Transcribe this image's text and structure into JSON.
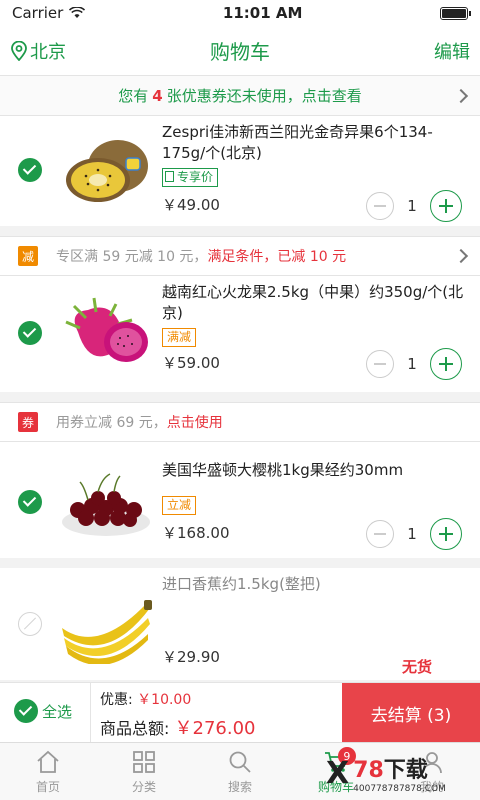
{
  "status": {
    "carrier": "Carrier",
    "time": "11:01 AM"
  },
  "nav": {
    "location": "北京",
    "title": "购物车",
    "edit": "编辑"
  },
  "coupon": {
    "prefix": "您有",
    "count": "4",
    "suffix": "张优惠券还未使用，点击查看"
  },
  "items": [
    {
      "name": "Zespri佳沛新西兰阳光金奇异果6个134-175g/个(北京)",
      "tag": "专享价",
      "price": "￥49.00",
      "qty": "1",
      "checked": true
    },
    {
      "name": "越南红心火龙果2.5kg（中果）约350g/个(北京)",
      "tag": "满减",
      "price": "￥59.00",
      "qty": "1",
      "checked": true
    },
    {
      "name": "美国华盛顿大樱桃1kg果经约30mm",
      "tag": "立减",
      "price": "￥168.00",
      "qty": "1",
      "checked": true
    },
    {
      "name": "进口香蕉约1.5kg(整把)",
      "price": "￥29.90",
      "checked": false,
      "status": "无货"
    }
  ],
  "promos": [
    {
      "badge": "减",
      "badge_color": "#f08a00",
      "gray": "专区满 59 元减 10 元，",
      "red": "满足条件，已减 10 元"
    },
    {
      "badge": "券",
      "badge_color": "#e6333c",
      "gray": "用券立减 69 元，",
      "red": "点击使用"
    }
  ],
  "summary": {
    "select_all": "全选",
    "discount_label": "优惠:",
    "discount_value": "￥10.00",
    "total_label": "商品总额:",
    "total_value": "￥276.00",
    "checkout": "去结算 (3)"
  },
  "tabs": [
    {
      "label": "首页",
      "icon": "home-icon"
    },
    {
      "label": "分类",
      "icon": "category-icon"
    },
    {
      "label": "搜索",
      "icon": "search-icon"
    },
    {
      "label": "购物车",
      "icon": "cart-icon",
      "badge": "9"
    },
    {
      "label": "我的",
      "icon": "user-icon"
    }
  ],
  "watermark": {
    "brand_x": "X",
    "brand_num": "78",
    "brand_text": "下载",
    "site": "400778787878.COM"
  },
  "colors": {
    "accent": "#1d9a4a",
    "red": "#e6333c",
    "orange": "#f08a00"
  }
}
